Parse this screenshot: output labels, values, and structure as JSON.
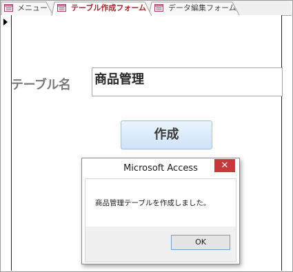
{
  "tabs": [
    {
      "label": "メニュー",
      "active": false
    },
    {
      "label": "テーブル作成フォーム",
      "active": true
    },
    {
      "label": "データ編集フォーム",
      "active": false
    }
  ],
  "form": {
    "table_name_label": "テーブル名",
    "table_name_value": "商品管理",
    "create_button_label": "作成"
  },
  "dialog": {
    "title": "Microsoft Access",
    "close_glyph": "✕",
    "message": "商品管理テーブルを作成しました。",
    "ok_label": "OK"
  },
  "colors": {
    "active_tab_text": "#a0272a",
    "close_button_bg": "#c7383b",
    "create_button_bg": "#d9eafb",
    "ok_button_border": "#6fa0d2"
  },
  "icons": {
    "form_tab_icon": "form-icon",
    "record_selector": "record-pointer-icon"
  }
}
